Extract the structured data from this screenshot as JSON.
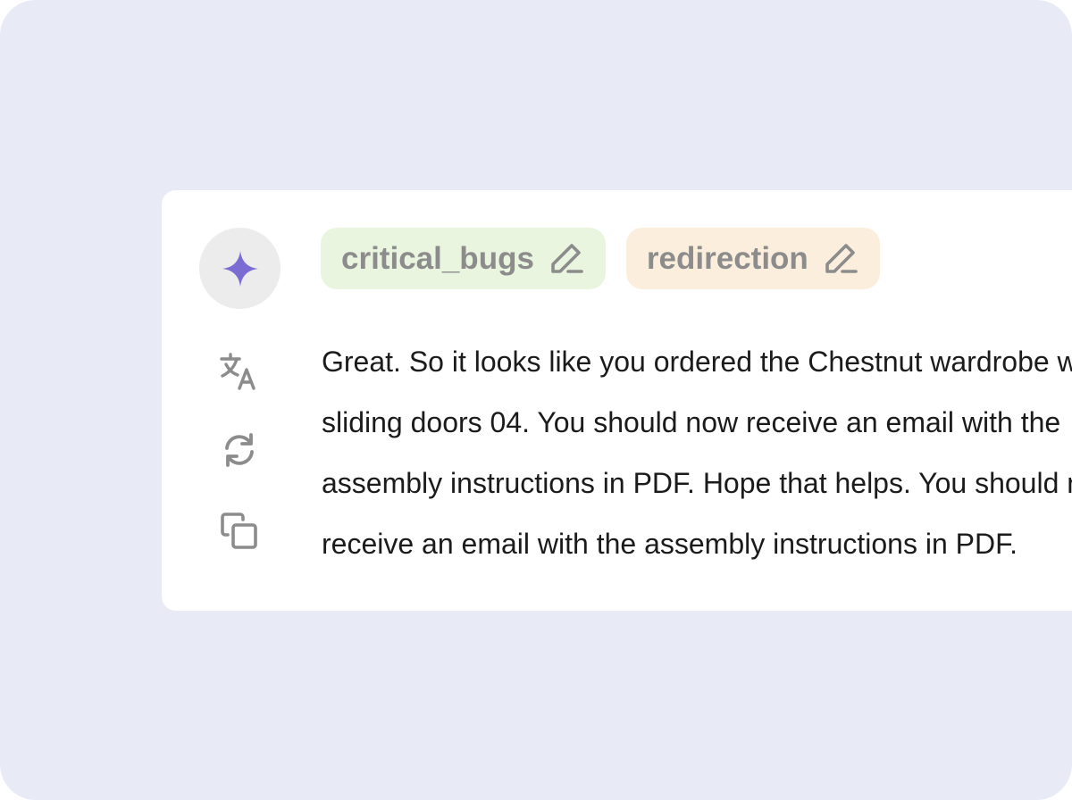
{
  "colors": {
    "background": "#e8eaf6",
    "card": "#ffffff",
    "sparkle": "#7b6cd4",
    "icon_gray": "#8c8c8c",
    "tag_green_bg": "#eaf5df",
    "tag_orange_bg": "#fbeedd",
    "text": "#1b1b1b"
  },
  "assistant": {
    "avatar_icon": "sparkle-icon"
  },
  "tools": [
    {
      "name": "translate",
      "icon": "translate-icon"
    },
    {
      "name": "regenerate",
      "icon": "refresh-icon"
    },
    {
      "name": "copy",
      "icon": "copy-icon"
    }
  ],
  "tags": [
    {
      "label": "critical_bugs",
      "icon": "pencil-icon"
    },
    {
      "label": "redirection",
      "icon": "pencil-icon"
    }
  ],
  "message": {
    "lines": [
      "Great. So it looks like you ordered the Chestnut wardrobe with",
      "sliding doors 04. You should now receive an email with the",
      "assembly instructions in PDF. Hope that helps. You should now",
      "receive an email with the assembly instructions in PDF."
    ]
  }
}
